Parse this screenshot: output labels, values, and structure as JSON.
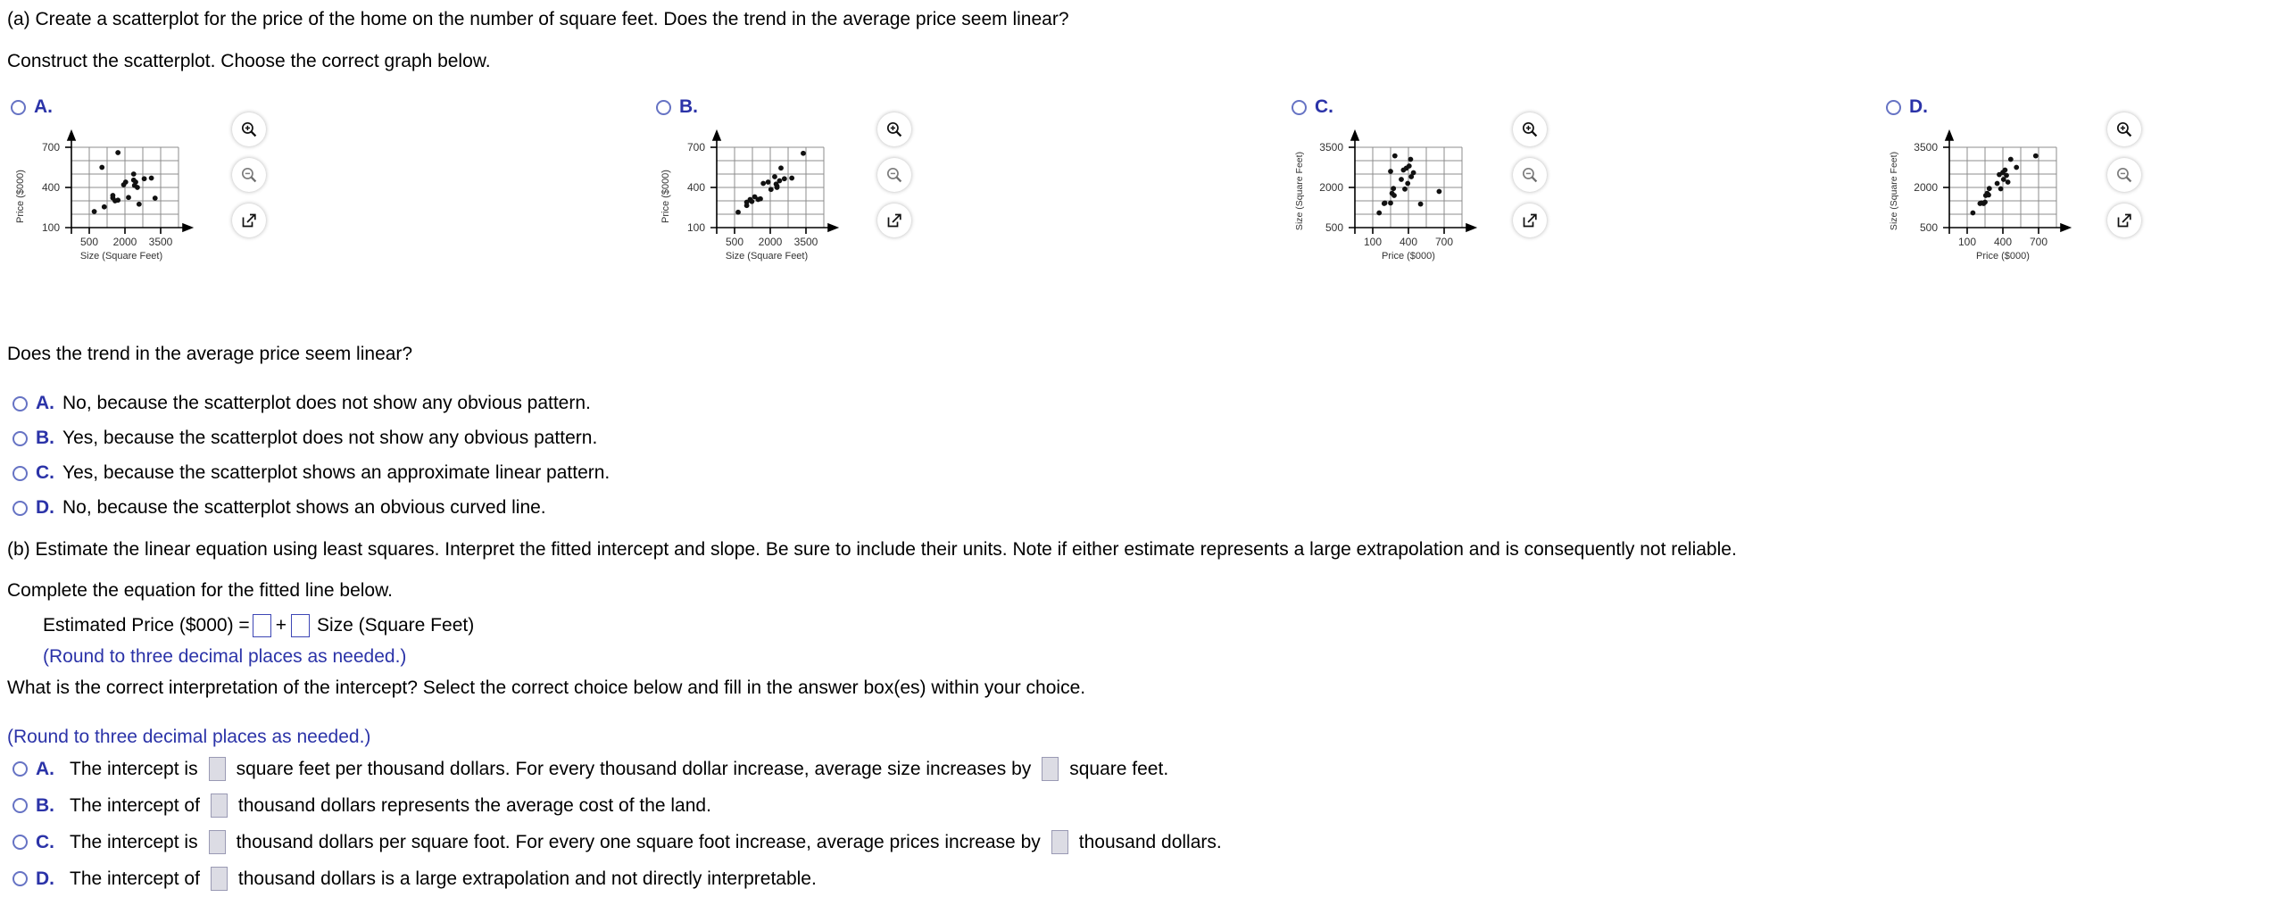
{
  "question": {
    "part_a_prompt": "(a) Create a scatterplot for the price of the home on the number of square feet. Does the trend in the average price seem linear?",
    "construct_line": "Construct the scatterplot. Choose the correct graph below.",
    "trend_question": "Does the trend in the average price seem linear?",
    "part_b_prompt": "(b) Estimate the linear equation using least squares. Interpret the fitted intercept and slope. Be sure to include their units. Note if either estimate represents a large extrapolation and is consequently not reliable.",
    "complete_equation_line": "Complete the equation for the fitted line below.",
    "intercept_question": "What is the correct interpretation of the intercept? Select the correct choice below and fill in the answer box(es) within your choice."
  },
  "equation": {
    "lhs": "Estimated Price ($000) =",
    "plus": "+",
    "rhs": "Size (Square Feet)",
    "round_note": "(Round to three decimal places as needed.)",
    "intercept_value": "",
    "slope_value": ""
  },
  "intercept_round_note": "(Round to three decimal places as needed.)",
  "graph_options": [
    {
      "letter": "A."
    },
    {
      "letter": "B."
    },
    {
      "letter": "C."
    },
    {
      "letter": "D."
    }
  ],
  "tools": {
    "zoom_in": "zoom-in-icon",
    "zoom_out": "zoom-out-icon",
    "expand": "open-in-new-icon"
  },
  "trend_answers": [
    {
      "letter": "A.",
      "text": "No, because the scatterplot does not show any obvious pattern."
    },
    {
      "letter": "B.",
      "text": "Yes, because the scatterplot does not show any obvious pattern."
    },
    {
      "letter": "C.",
      "text": "Yes, because the scatterplot shows an approximate linear pattern."
    },
    {
      "letter": "D.",
      "text": "No, because the scatterplot shows an obvious curved line."
    }
  ],
  "intercept_answers": [
    {
      "letter": "A.",
      "pre": "The intercept is",
      "mid": "square feet per thousand dollars. For every thousand dollar increase, average size increases by",
      "post": "square feet.",
      "boxes": 2
    },
    {
      "letter": "B.",
      "pre": "The intercept of",
      "mid": "thousand dollars represents the average cost of the land.",
      "post": "",
      "boxes": 1
    },
    {
      "letter": "C.",
      "pre": "The intercept is",
      "mid": "thousand dollars per square foot. For every one square foot increase, average prices increase by",
      "post": "thousand dollars.",
      "boxes": 2
    },
    {
      "letter": "D.",
      "pre": "The intercept of",
      "mid": "thousand dollars is a large extrapolation and not directly interpretable.",
      "post": "",
      "boxes": 1
    }
  ],
  "chart_data": [
    {
      "id": "A",
      "type": "scatter",
      "title": "",
      "xlabel": "Size (Square Feet)",
      "ylabel": "Price ($000)",
      "xticks": [
        500,
        2000,
        3500
      ],
      "yticks": [
        100,
        400,
        700
      ],
      "xlim": [
        250,
        4000
      ],
      "ylim": [
        100,
        700
      ],
      "grid": true,
      "points": [
        [
          1050,
          220
        ],
        [
          1400,
          255
        ],
        [
          1320,
          550
        ],
        [
          1700,
          322
        ],
        [
          1780,
          300
        ],
        [
          1700,
          340
        ],
        [
          1880,
          305
        ],
        [
          1880,
          660
        ],
        [
          2080,
          420
        ],
        [
          2150,
          440
        ],
        [
          2250,
          325
        ],
        [
          2430,
          500
        ],
        [
          2430,
          455
        ],
        [
          2460,
          415
        ],
        [
          2500,
          440
        ],
        [
          2560,
          400
        ],
        [
          2620,
          275
        ],
        [
          2800,
          465
        ],
        [
          3050,
          470
        ],
        [
          3180,
          320
        ]
      ]
    },
    {
      "id": "B",
      "type": "scatter",
      "title": "",
      "xlabel": "Size (Square Feet)",
      "ylabel": "Price ($000)",
      "xticks": [
        500,
        2000,
        3500
      ],
      "yticks": [
        100,
        400,
        700
      ],
      "xlim": [
        250,
        4000
      ],
      "ylim": [
        100,
        700
      ],
      "grid": true,
      "points": [
        [
          1000,
          215
        ],
        [
          1300,
          265
        ],
        [
          1300,
          290
        ],
        [
          1420,
          310
        ],
        [
          1480,
          295
        ],
        [
          1580,
          330
        ],
        [
          1700,
          310
        ],
        [
          1780,
          315
        ],
        [
          1880,
          430
        ],
        [
          2050,
          440
        ],
        [
          2150,
          385
        ],
        [
          2280,
          480
        ],
        [
          2330,
          425
        ],
        [
          2360,
          410
        ],
        [
          2360,
          400
        ],
        [
          2450,
          450
        ],
        [
          2500,
          545
        ],
        [
          2620,
          465
        ],
        [
          2880,
          470
        ],
        [
          3280,
          655
        ]
      ]
    },
    {
      "id": "C",
      "type": "scatter",
      "title": "",
      "xlabel": "Price ($000)",
      "ylabel": "Size (Square Feet)",
      "xticks": [
        100,
        400,
        700
      ],
      "yticks": [
        500,
        2000,
        3500
      ],
      "xlim": [
        50,
        800
      ],
      "ylim": [
        500,
        3500
      ],
      "grid": true,
      "points": [
        [
          220,
          1050
        ],
        [
          255,
          1400
        ],
        [
          260,
          1420
        ],
        [
          300,
          1420
        ],
        [
          310,
          1780
        ],
        [
          300,
          2600
        ],
        [
          320,
          1960
        ],
        [
          325,
          1700
        ],
        [
          330,
          3180
        ],
        [
          375,
          2300
        ],
        [
          390,
          2650
        ],
        [
          400,
          1940
        ],
        [
          410,
          2720
        ],
        [
          420,
          2150
        ],
        [
          430,
          2800
        ],
        [
          440,
          3050
        ],
        [
          445,
          2400
        ],
        [
          460,
          2550
        ],
        [
          510,
          1380
        ],
        [
          640,
          1850
        ]
      ]
    },
    {
      "id": "D",
      "type": "scatter",
      "title": "",
      "xlabel": "Price ($000)",
      "ylabel": "Size (Square Feet)",
      "xticks": [
        100,
        400,
        700
      ],
      "yticks": [
        500,
        2000,
        3500
      ],
      "xlim": [
        50,
        800
      ],
      "ylim": [
        500,
        3500
      ],
      "grid": true,
      "points": [
        [
          215,
          1050
        ],
        [
          265,
          1400
        ],
        [
          275,
          1420
        ],
        [
          290,
          1400
        ],
        [
          300,
          1450
        ],
        [
          305,
          1700
        ],
        [
          315,
          1780
        ],
        [
          325,
          1720
        ],
        [
          330,
          1960
        ],
        [
          385,
          2150
        ],
        [
          400,
          2480
        ],
        [
          410,
          1950
        ],
        [
          425,
          2560
        ],
        [
          430,
          2300
        ],
        [
          440,
          2650
        ],
        [
          450,
          2450
        ],
        [
          460,
          2200
        ],
        [
          480,
          3050
        ],
        [
          520,
          2750
        ],
        [
          655,
          3180
        ]
      ]
    }
  ]
}
